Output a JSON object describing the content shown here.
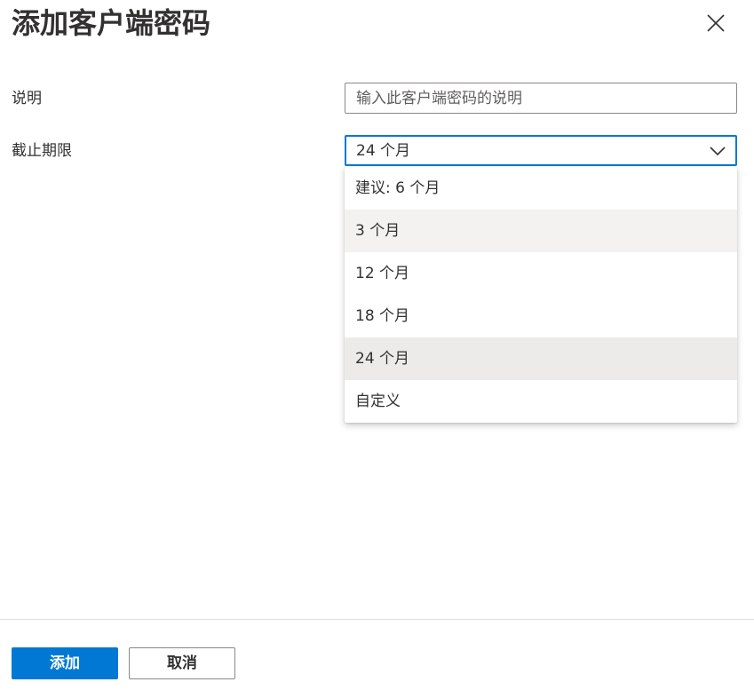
{
  "dialog": {
    "title": "添加客户端密码",
    "close_icon": "close-icon"
  },
  "form": {
    "description": {
      "label": "说明",
      "value": "",
      "placeholder": "输入此客户端密码的说明"
    },
    "expires": {
      "label": "截止期限",
      "selected": "24 个月",
      "chevron_icon": "chevron-down-icon",
      "expanded": true,
      "options": [
        {
          "label": "建议: 6 个月",
          "state": "normal"
        },
        {
          "label": "3 个月",
          "state": "hover"
        },
        {
          "label": "12 个月",
          "state": "normal"
        },
        {
          "label": "18 个月",
          "state": "normal"
        },
        {
          "label": "24 个月",
          "state": "selected"
        },
        {
          "label": "自定义",
          "state": "normal"
        }
      ]
    }
  },
  "footer": {
    "add_label": "添加",
    "cancel_label": "取消"
  },
  "colors": {
    "accent": "#0078d4",
    "text": "#323130",
    "option_hover": "#f3f2f1",
    "option_selected": "#edebe9"
  }
}
